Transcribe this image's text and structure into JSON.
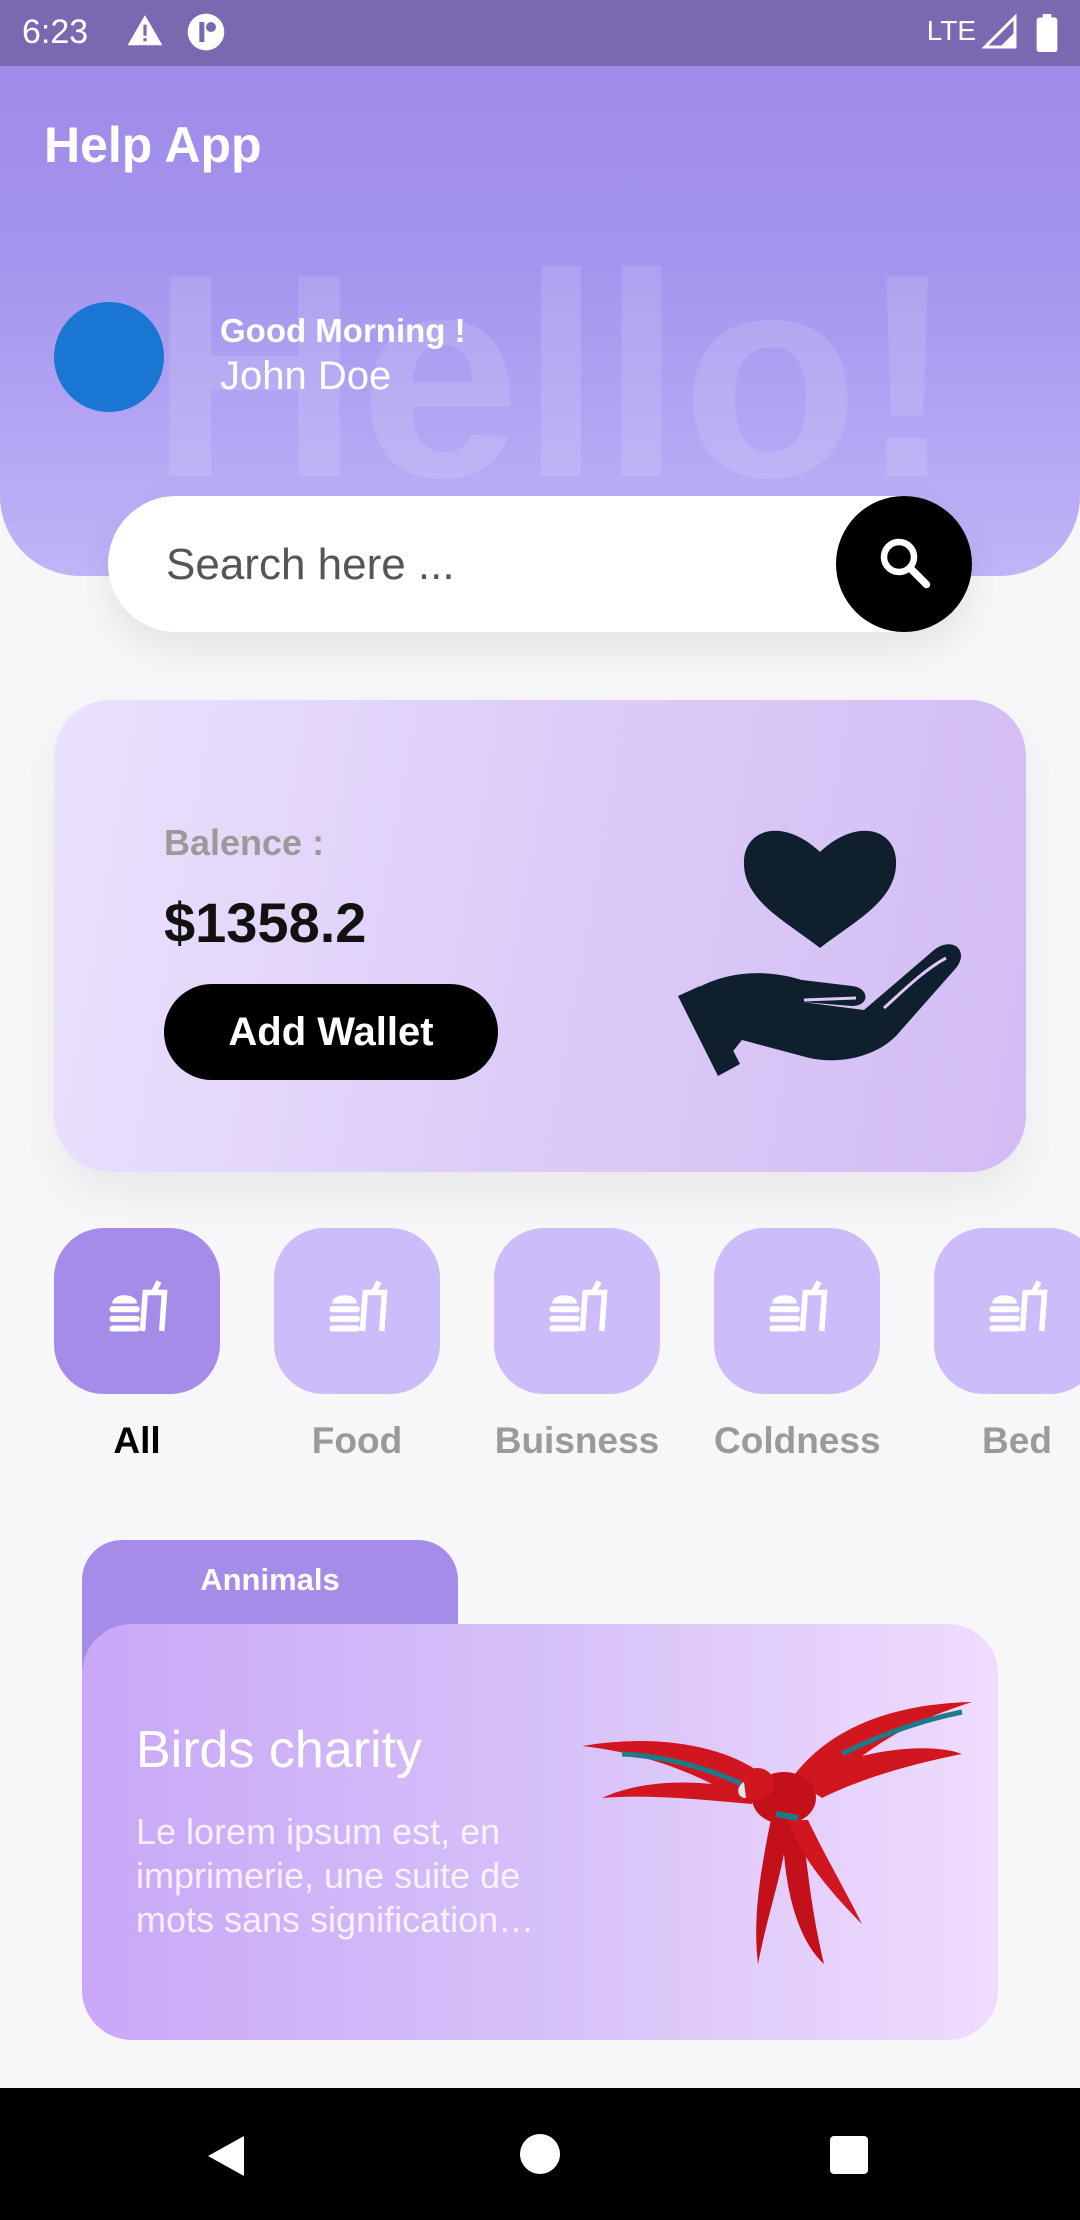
{
  "status_bar": {
    "time": "6:23",
    "network": "LTE"
  },
  "header": {
    "app_title": "Help App",
    "background_word": "Hello!",
    "greeting": "Good Morning !",
    "username": "John Doe"
  },
  "search": {
    "placeholder": "Search here ..."
  },
  "balance": {
    "label": "Balence :",
    "value": "$1358.2",
    "button_label": "Add Wallet"
  },
  "categories": [
    {
      "label": "All",
      "active": true
    },
    {
      "label": "Food",
      "active": false
    },
    {
      "label": "Buisness",
      "active": false
    },
    {
      "label": "Coldness",
      "active": false
    },
    {
      "label": "Bed",
      "active": false
    }
  ],
  "featured": {
    "tab_label": "Annimals",
    "title": "Birds charity",
    "description": "Le lorem ipsum est, en imprimerie, une suite de mots sans signification…"
  },
  "colors": {
    "header": "#9e8be8",
    "category_active": "#a58ce9",
    "category_inactive": "#cdbcfa",
    "avatar": "#1976d2"
  }
}
